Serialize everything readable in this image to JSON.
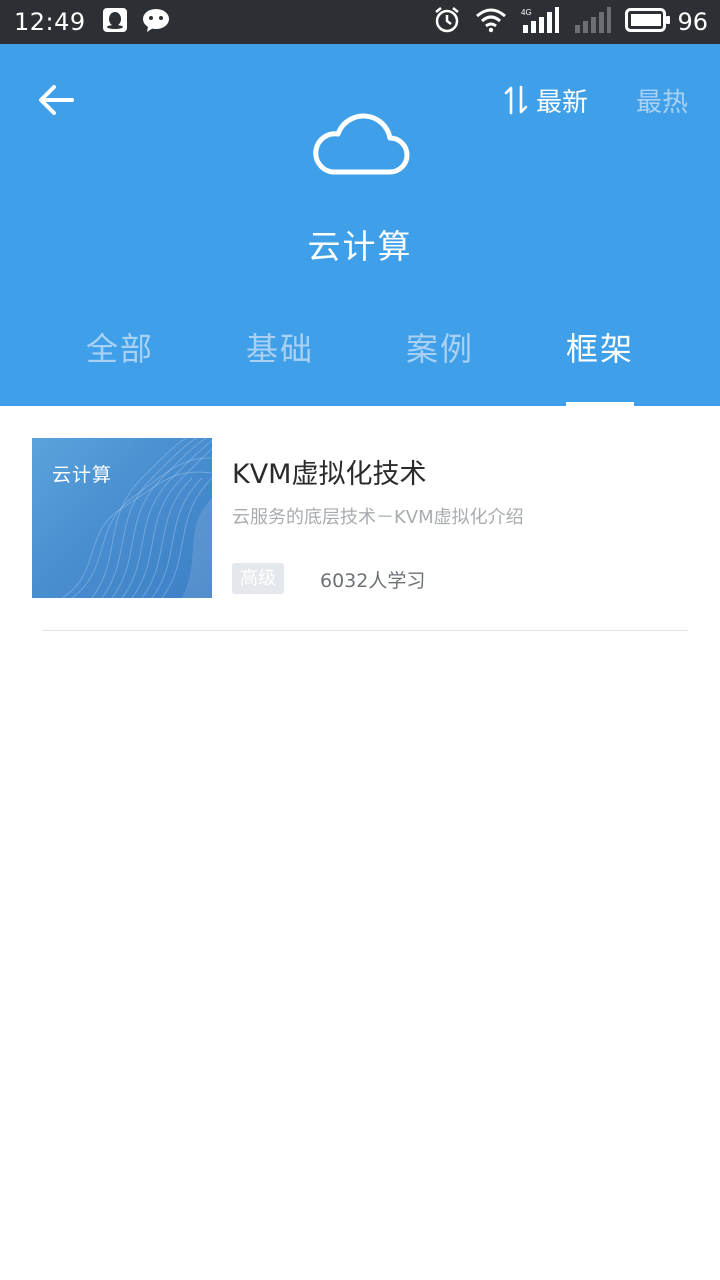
{
  "status_bar": {
    "time": "12:49",
    "battery": "96",
    "network": "4G",
    "icons": [
      "qq-icon",
      "wechat-icon",
      "alarm-icon",
      "wifi-icon",
      "signal-icon",
      "signal-weak-icon",
      "battery-icon"
    ]
  },
  "header": {
    "back_icon": "arrow-left-icon",
    "sort_latest": "最新",
    "sort_hot": "最热",
    "cloud_icon": "cloud-icon",
    "title": "云计算",
    "bg_color": "#3fa0e9"
  },
  "tabs": [
    {
      "label": "全部",
      "active": false
    },
    {
      "label": "基础",
      "active": false
    },
    {
      "label": "案例",
      "active": false
    },
    {
      "label": "框架",
      "active": true
    }
  ],
  "courses": [
    {
      "thumb_label": "云计算",
      "title": "KVM虚拟化技术",
      "description": "云服务的底层技术－KVM虚拟化介绍",
      "level": "高级",
      "learners": "6032人学习"
    }
  ]
}
